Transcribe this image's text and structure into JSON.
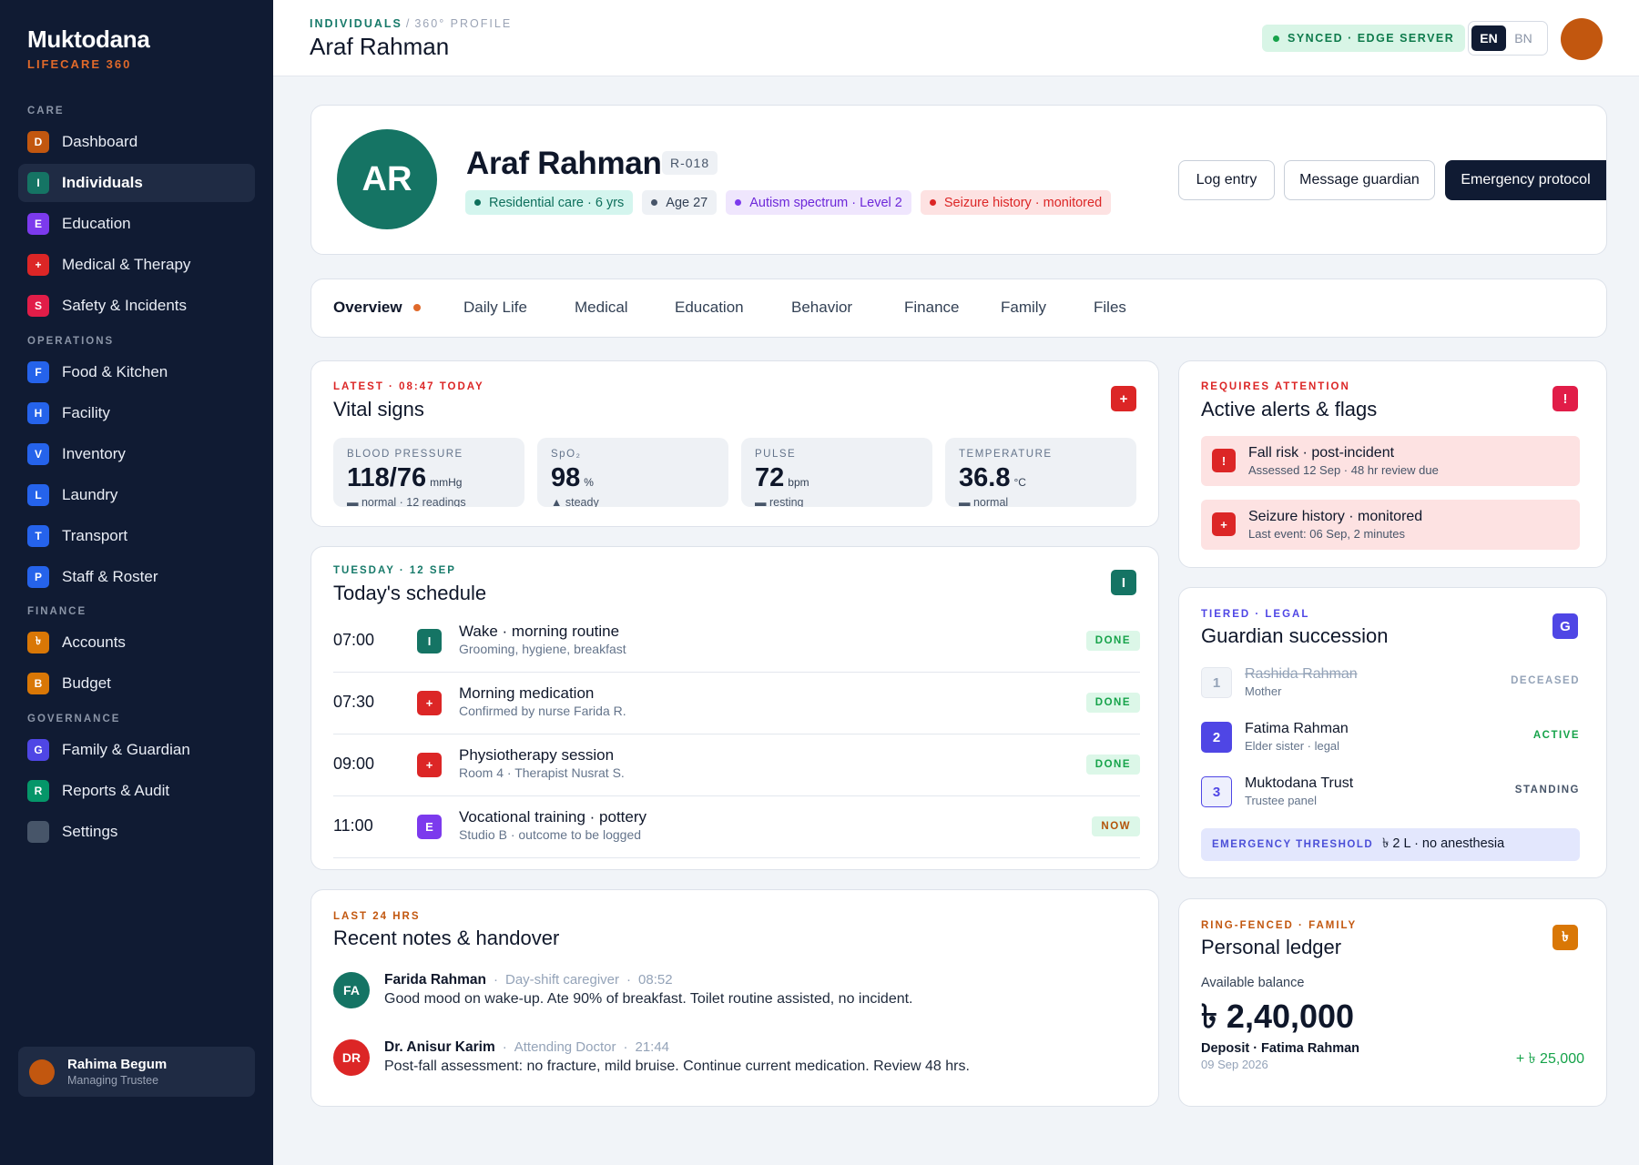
{
  "app": {
    "name": "Muktodana",
    "subtitle": "LIFECARE 360"
  },
  "sidebar": {
    "sections": [
      {
        "title": "CARE",
        "items": [
          {
            "label": "Dashboard",
            "badge": "D",
            "color": "#c2570f"
          },
          {
            "label": "Individuals",
            "badge": "I",
            "color": "#157464",
            "active": true
          },
          {
            "label": "Education",
            "badge": "E",
            "color": "#7c3aed"
          },
          {
            "label": "Medical & Therapy",
            "badge": "+",
            "color": "#dc2626"
          },
          {
            "label": "Safety & Incidents",
            "badge": "S",
            "color": "#e11d48"
          }
        ]
      },
      {
        "title": "OPERATIONS",
        "items": [
          {
            "label": "Food & Kitchen",
            "badge": "F",
            "color": "#2563eb"
          },
          {
            "label": "Facility",
            "badge": "H",
            "color": "#2563eb"
          },
          {
            "label": "Inventory",
            "badge": "V",
            "color": "#2563eb"
          },
          {
            "label": "Laundry",
            "badge": "L",
            "color": "#2563eb"
          },
          {
            "label": "Transport",
            "badge": "T",
            "color": "#2563eb"
          },
          {
            "label": "Staff & Roster",
            "badge": "P",
            "color": "#2563eb"
          }
        ]
      },
      {
        "title": "FINANCE",
        "items": [
          {
            "label": "Accounts",
            "badge": "৳",
            "color": "#d97706"
          },
          {
            "label": "Budget",
            "badge": "B",
            "color": "#d97706"
          }
        ]
      },
      {
        "title": "GOVERNANCE",
        "items": [
          {
            "label": "Family & Guardian",
            "badge": "G",
            "color": "#4f46e5"
          },
          {
            "label": "Reports & Audit",
            "badge": "R",
            "color": "#059669"
          },
          {
            "label": "Settings",
            "badge": "",
            "color": "#475569"
          }
        ]
      }
    ],
    "user": {
      "name": "Rahima Begum",
      "role": "Managing Trustee"
    }
  },
  "topbar": {
    "crumb_section": "INDIVIDUALS",
    "crumb_sep": "/",
    "crumb_page": "360° PROFILE",
    "title": "Araf Rahman",
    "sync_status": "SYNCED · EDGE SERVER",
    "lang_en": "EN",
    "lang_bn": "BN"
  },
  "profile": {
    "initials": "AR",
    "name": "Araf Rahman",
    "id": "R-018",
    "tags": [
      {
        "label": "Residential care · 6 yrs",
        "bg": "#d4f5ee",
        "fg": "#0e6f5c",
        "dot": "#0e6f5c"
      },
      {
        "label": "Age 27",
        "bg": "#eef1f5",
        "fg": "#334155",
        "dot": "#475569"
      },
      {
        "label": "Autism spectrum · Level 2",
        "bg": "#efe6fd",
        "fg": "#6d28d9",
        "dot": "#7c3aed"
      },
      {
        "label": "Seizure history · monitored",
        "bg": "#fde2e2",
        "fg": "#dc2626",
        "dot": "#dc2626"
      }
    ],
    "actions": {
      "log": "Log entry",
      "message": "Message guardian",
      "emergency": "Emergency protocol"
    }
  },
  "tabs": [
    "Overview",
    "Daily Life",
    "Medical",
    "Education",
    "Behavior",
    "Finance",
    "Family",
    "Files"
  ],
  "vitals": {
    "eyebrow": "LATEST · 08:47 TODAY",
    "title": "Vital signs",
    "icon": "+",
    "items": [
      {
        "label": "BLOOD PRESSURE",
        "value": "118/76",
        "unit": "mmHg",
        "trend": "▬",
        "sub": "normal · 12 readings"
      },
      {
        "label": "SpO₂",
        "value": "98",
        "unit": "%",
        "trend": "▲",
        "sub": "steady"
      },
      {
        "label": "PULSE",
        "value": "72",
        "unit": "bpm",
        "trend": "▬",
        "sub": "resting"
      },
      {
        "label": "TEMPERATURE",
        "value": "36.8",
        "unit": "°C",
        "trend": "▬",
        "sub": "normal"
      }
    ]
  },
  "schedule": {
    "eyebrow": "TUESDAY · 12 SEP",
    "title": "Today's schedule",
    "icon": "I",
    "items": [
      {
        "time": "07:00",
        "icon": "I",
        "color": "#157464",
        "title": "Wake · morning routine",
        "sub": "Grooming, hygiene, breakfast",
        "status": "DONE"
      },
      {
        "time": "07:30",
        "icon": "+",
        "color": "#dc2626",
        "title": "Morning medication",
        "sub": "Confirmed by nurse Farida R.",
        "status": "DONE"
      },
      {
        "time": "09:00",
        "icon": "+",
        "color": "#dc2626",
        "title": "Physiotherapy session",
        "sub": "Room 4 · Therapist Nusrat S.",
        "status": "DONE"
      },
      {
        "time": "11:00",
        "icon": "E",
        "color": "#7c3aed",
        "title": "Vocational training · pottery",
        "sub": "Studio B · outcome to be logged",
        "status": "NOW"
      }
    ]
  },
  "notes": {
    "eyebrow": "LAST 24 HRS",
    "title": "Recent notes & handover",
    "items": [
      {
        "initials": "FA",
        "color": "#157464",
        "author": "Farida Rahman",
        "role": "Day-shift caregiver",
        "time": "08:52",
        "text": "Good mood on wake-up. Ate 90% of breakfast. Toilet routine assisted, no incident."
      },
      {
        "initials": "DR",
        "color": "#dc2626",
        "author": "Dr. Anisur Karim",
        "role": "Attending Doctor",
        "time": "21:44",
        "text": "Post-fall assessment: no fracture, mild bruise. Continue current medication. Review 48 hrs."
      }
    ]
  },
  "alerts": {
    "eyebrow": "REQUIRES ATTENTION",
    "title": "Active alerts & flags",
    "icon": "!",
    "items": [
      {
        "icon": "!",
        "title": "Fall risk · post-incident",
        "sub": "Assessed 12 Sep · 48 hr review due"
      },
      {
        "icon": "+",
        "title": "Seizure history · monitored",
        "sub": "Last event: 06 Sep, 2 minutes"
      }
    ]
  },
  "guardians": {
    "eyebrow": "TIERED · LEGAL",
    "title": "Guardian succession",
    "icon": "G",
    "items": [
      {
        "num": "1",
        "name": "Rashida Rahman",
        "rel": "Mother",
        "status": "DECEASED"
      },
      {
        "num": "2",
        "name": "Fatima Rahman",
        "rel": "Elder sister · legal",
        "status": "ACTIVE"
      },
      {
        "num": "3",
        "name": "Muktodana Trust",
        "rel": "Trustee panel",
        "status": "STANDING"
      }
    ],
    "threshold_label": "EMERGENCY THRESHOLD",
    "threshold_value": "৳ 2 L · no anesthesia"
  },
  "ledger": {
    "eyebrow": "RING-FENCED · FAMILY",
    "title": "Personal ledger",
    "icon": "৳",
    "balance_label": "Available balance",
    "balance": "৳ 2,40,000",
    "last_title": "Deposit · Fatima Rahman",
    "last_date": "09 Sep 2026",
    "last_amount": "+ ৳ 25,000"
  },
  "colors": {
    "accent": "#157464",
    "sidebar": "#101b33",
    "danger": "#dc2626",
    "brand_orange": "#e0692a"
  }
}
